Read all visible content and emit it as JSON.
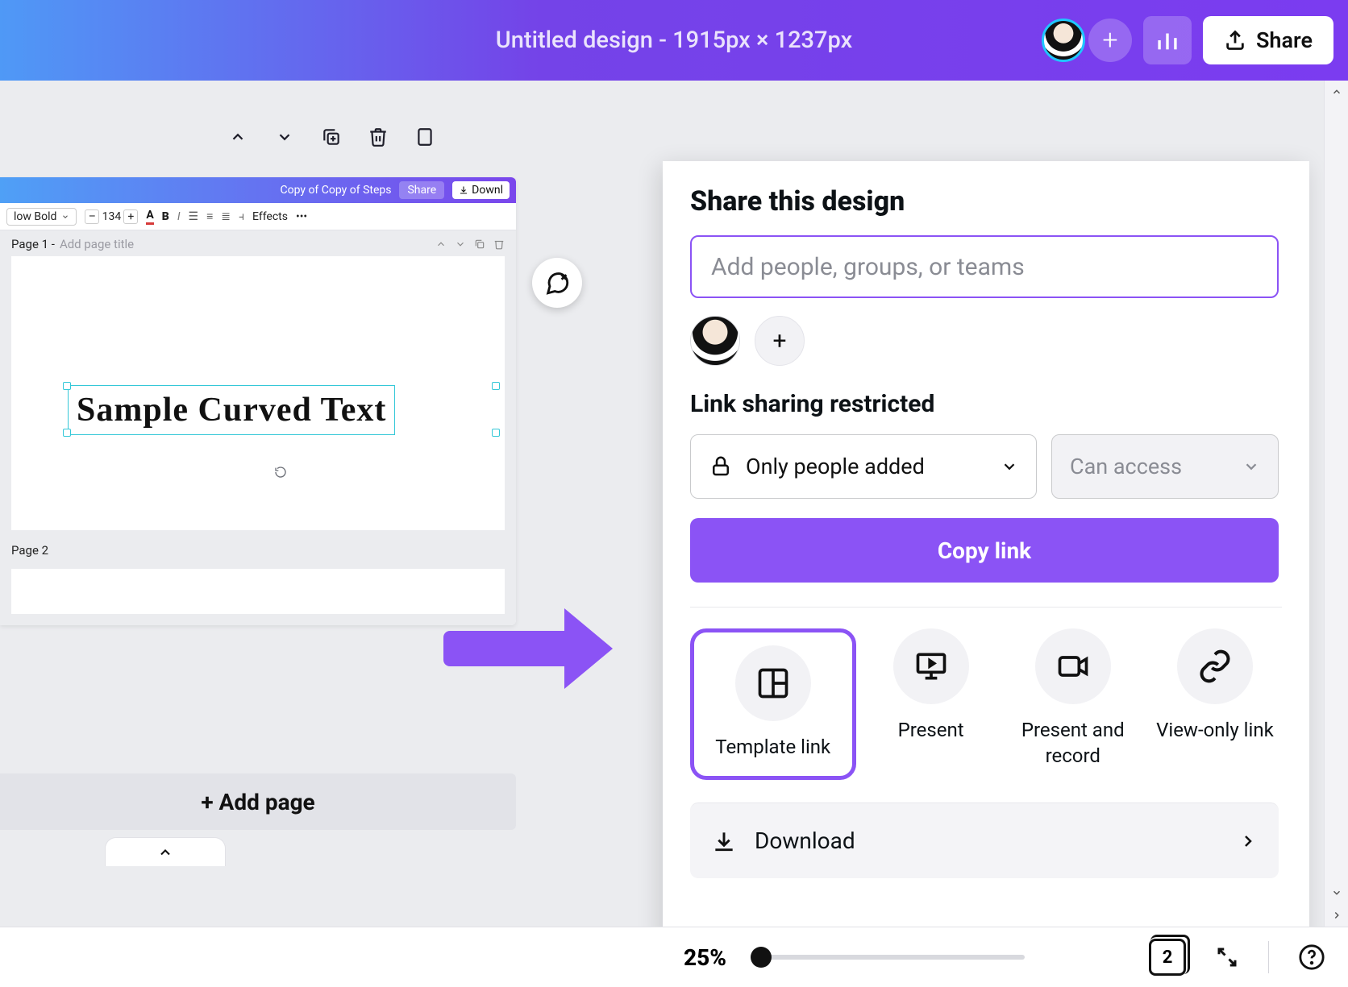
{
  "topbar": {
    "title": "Untitled design - 1915px × 1237px",
    "share_label": "Share"
  },
  "editor_snap": {
    "header_title": "Copy of Copy of Steps",
    "header_share": "Share",
    "header_download": "Downl",
    "font_name": "low Bold",
    "font_size": "134",
    "effects_label": "Effects",
    "page1_label": "Page 1 -",
    "page1_placeholder": "Add page title",
    "page2_label": "Page 2",
    "sample_text": "Sample Curved Text"
  },
  "addpage_label": "+ Add page",
  "share_panel": {
    "heading": "Share this design",
    "input_placeholder": "Add people, groups, or teams",
    "link_status": "Link sharing restricted",
    "access_select": "Only people added",
    "permission_select": "Can access",
    "copy_link": "Copy link",
    "actions": {
      "template": "Template link",
      "present": "Present",
      "present_record": "Present and record",
      "view_only": "View-only link"
    },
    "download": "Download"
  },
  "status": {
    "zoom": "25%",
    "page_count": "2"
  }
}
